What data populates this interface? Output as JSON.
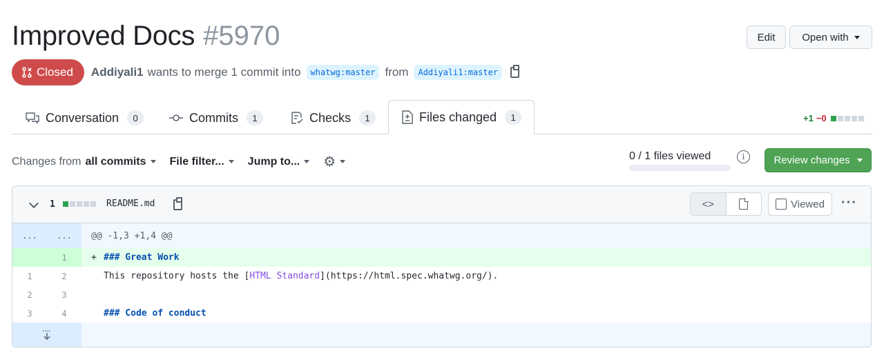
{
  "pr": {
    "title": "Improved Docs",
    "number": "#5970",
    "state": "Closed",
    "author": "Addiyali1",
    "merge_text": "wants to merge 1 commit into",
    "base_branch": "whatwg:master",
    "from_text": "from",
    "head_branch": "Addiyali1:master"
  },
  "header_actions": {
    "edit_label": "Edit",
    "open_with_label": "Open with"
  },
  "tabs": [
    {
      "label": "Conversation",
      "count": "0",
      "icon": "comment-icon"
    },
    {
      "label": "Commits",
      "count": "1",
      "icon": "commit-icon"
    },
    {
      "label": "Checks",
      "count": "1",
      "icon": "checklist-icon"
    },
    {
      "label": "Files changed",
      "count": "1",
      "icon": "file-diff-icon"
    }
  ],
  "diffstat": {
    "added": "+1",
    "removed": "−0"
  },
  "toolbar": {
    "changes_from_prefix": "Changes from",
    "changes_from_value": "all commits",
    "file_filter": "File filter...",
    "jump_to": "Jump to...",
    "files_viewed": "0 / 1 files viewed",
    "files_viewed_fraction": 0,
    "review_changes": "Review changes"
  },
  "file": {
    "change_count": "1",
    "name": "README.md",
    "viewed_label": "Viewed",
    "hunk_header": "@@ -1,3 +1,4 @@",
    "hunk_old": "...",
    "hunk_new": "...",
    "lines": [
      {
        "old": "",
        "new": "1",
        "sign": "+",
        "type": "added"
      },
      {
        "old": "1",
        "new": "2",
        "sign": "",
        "type": "context"
      },
      {
        "old": "2",
        "new": "3",
        "sign": "",
        "type": "context"
      },
      {
        "old": "3",
        "new": "4",
        "sign": "",
        "type": "context"
      }
    ],
    "line1_text": "### Great Work",
    "line2_prefix": "This repository hosts the [",
    "line2_link": "HTML Standard",
    "line2_suffix": "](https://html.spec.whatwg.org/).",
    "line4_text": "### Code of conduct"
  },
  "colors": {
    "closed_badge": "#cf4b4b",
    "review_button": "#4fa354",
    "added_line": "#e6ffec",
    "hunk_bg": "#f1f8ff"
  }
}
